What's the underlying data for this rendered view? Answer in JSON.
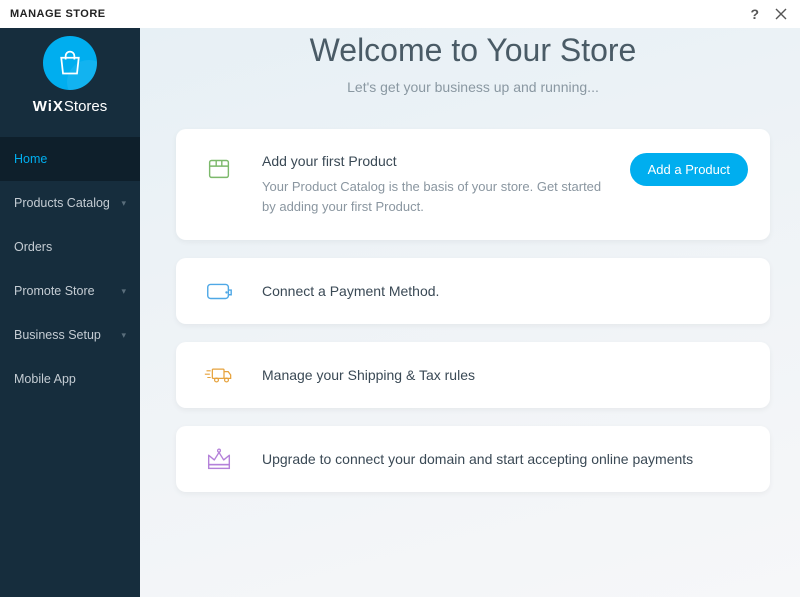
{
  "topbar": {
    "title": "MANAGE STORE"
  },
  "brand": {
    "name_bold": "WiX",
    "name_light": "Stores"
  },
  "sidebar": {
    "items": [
      {
        "label": "Home",
        "active": true,
        "expandable": false
      },
      {
        "label": "Products Catalog",
        "active": false,
        "expandable": true
      },
      {
        "label": "Orders",
        "active": false,
        "expandable": false
      },
      {
        "label": "Promote Store",
        "active": false,
        "expandable": true
      },
      {
        "label": "Business Setup",
        "active": false,
        "expandable": true
      },
      {
        "label": "Mobile App",
        "active": false,
        "expandable": false
      }
    ]
  },
  "welcome": {
    "title": "Welcome to Your Store",
    "subtitle": "Let's get your business up and running..."
  },
  "cards": {
    "product": {
      "title": "Add your first Product",
      "desc": "Your Product Catalog is the basis of your store. Get started by adding your first Product.",
      "button": "Add a Product"
    },
    "payment": {
      "title": "Connect a Payment Method."
    },
    "shipping": {
      "title": "Manage your Shipping & Tax rules"
    },
    "upgrade": {
      "title": "Upgrade to connect your domain and start accepting online payments"
    }
  }
}
